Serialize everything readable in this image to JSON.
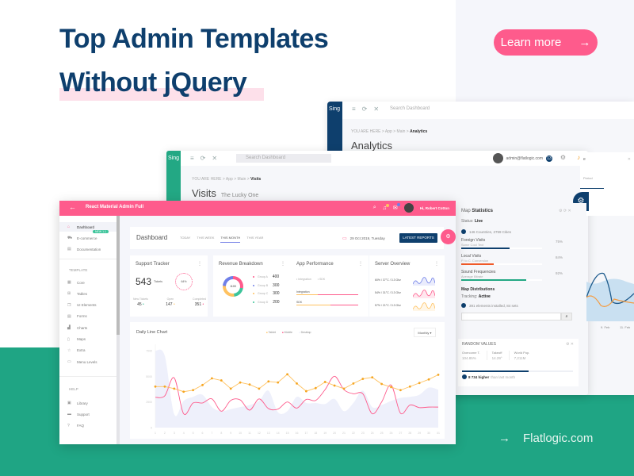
{
  "hero": {
    "title": "Top Admin Templates",
    "subtitle": "Without jQuery",
    "cta_label": "Learn more",
    "cta_arrow": "→",
    "footer_link": "Flatlogic.com",
    "footer_arrow": "→"
  },
  "colors": {
    "navy": "#0e3f6d",
    "pink": "#fe5b8c",
    "green": "#1fa584",
    "orange": "#ffc260"
  },
  "analytics_window": {
    "logo": "Sing",
    "search_placeholder": "Search Dashboard",
    "breadcrumb_prefix": "YOU ARE HERE > App > Main > ",
    "breadcrumb_current": "Analytics",
    "page_title": "Analytics"
  },
  "visits_window": {
    "logo": "Sing",
    "search_placeholder": "Search Dashboard",
    "breadcrumb_prefix": "YOU ARE HERE > App > Main > ",
    "breadcrumb_current": "Visits",
    "page_title": "Visits",
    "page_subtitle": "The Lucky One",
    "user_email": "admin@flatlogic.com",
    "user_badge": "13",
    "map_statistics": {
      "title_light": "Map",
      "title_bold": "Statistics",
      "status_label": "Status:",
      "status_value": "Live",
      "countries_text": "146 Countries, 2759 Cities",
      "rows": [
        {
          "label": "Foreign Visits",
          "sub": "Some Cool Text",
          "percent": "75%",
          "fill": 0.6,
          "color": "#0e3f6d"
        },
        {
          "label": "Local Visits",
          "sub": "P. to C. Conversion",
          "percent": "84%",
          "fill": 0.4,
          "color": "#f05a28"
        },
        {
          "label": "Sound Frequencies",
          "sub": "Average Bitrate",
          "percent": "92%",
          "fill": 0.8,
          "color": "#23a884"
        }
      ],
      "distributions_title": "Map Distributions",
      "tracking_label": "Tracking:",
      "tracking_value": "Active",
      "elements_text": "391 elements installed, 84 sets"
    },
    "random_values": {
      "title": "RANDOM VALUES",
      "columns": [
        {
          "label": "Overcome T.",
          "value": "104.85%"
        },
        {
          "label": "Takeoff",
          "value": "14.29°"
        },
        {
          "label": "World Pop.",
          "value": "7,211M"
        }
      ],
      "progress": 0.6,
      "note_bold": "8 734 higher",
      "note_rest": "than last month"
    },
    "side_panel": {
      "title": "e",
      "subtitle": "Period"
    },
    "mini_chart_ticks": [
      "9. Feb",
      "11. Feb"
    ]
  },
  "react_window": {
    "title": "React Material Admin Full",
    "user_greeting": "Hi, Robert Cotton",
    "sidebar": {
      "items": [
        {
          "label": "Dashboard",
          "icon": "home",
          "active": true
        },
        {
          "label": "E-commerce",
          "icon": "cart",
          "tag": "NEW 1.1"
        },
        {
          "label": "Documentation",
          "icon": "doc"
        }
      ],
      "template_section": "TEMPLATE",
      "template_items": [
        {
          "label": "Core",
          "icon": "grid"
        },
        {
          "label": "Tables",
          "icon": "table"
        },
        {
          "label": "UI Elements",
          "icon": "layers"
        },
        {
          "label": "Forms",
          "icon": "doc"
        },
        {
          "label": "Charts",
          "icon": "chart"
        },
        {
          "label": "Maps",
          "icon": "map"
        },
        {
          "label": "Extra",
          "icon": "star"
        },
        {
          "label": "Menu Levels",
          "icon": "folder"
        }
      ],
      "help_section": "HELP",
      "help_items": [
        {
          "label": "Library",
          "icon": "library"
        },
        {
          "label": "Support",
          "icon": "chat"
        },
        {
          "label": "FAQ",
          "icon": "help"
        }
      ]
    },
    "dashboard": {
      "title": "Dashboard",
      "tabs": [
        "TODAY",
        "THIS WEEK",
        "THIS MONTH",
        "THIS YEAR"
      ],
      "active_tab": "THIS MONTH",
      "date": "29 Oct 2019, Tuesday",
      "latest_reports_label": "LATEST REPORTS"
    },
    "support_tracker": {
      "title": "Support Tracker",
      "tickets_count": "543",
      "tickets_label": "Tickets",
      "ring_value": "64%",
      "stats": [
        {
          "label": "New Tickets",
          "value": "45"
        },
        {
          "label": "Open",
          "value": "147"
        },
        {
          "label": "Completed",
          "value": "351"
        }
      ]
    },
    "revenue_breakdown": {
      "title": "Revenue Breakdown",
      "center_value": "1100",
      "groups": [
        {
          "label": "Group A",
          "value": "400",
          "color": "#fe5b8c"
        },
        {
          "label": "Group B",
          "value": "300",
          "color": "#6f7fe8"
        },
        {
          "label": "Group C",
          "value": "300",
          "color": "#ffc260"
        },
        {
          "label": "Group D",
          "value": "200",
          "color": "#3cc49a"
        }
      ]
    },
    "app_performance": {
      "title": "App Performance",
      "legend": [
        "Integration",
        "SDK"
      ],
      "bars": [
        {
          "label": "Integration",
          "fill": 0.35
        },
        {
          "label": "SDK",
          "fill": 0.55
        }
      ]
    },
    "server_overview": {
      "title": "Server Overview",
      "rows": [
        {
          "text": "60% / 37°C / 3.3 Ghz",
          "color": "#6f7fe8"
        },
        {
          "text": "54% / 31°C / 3.3 Ghz",
          "color": "#fe5b8c"
        },
        {
          "text": "57% / 21°C / 3.3 Ghz",
          "color": "#ffc260"
        }
      ]
    },
    "daily_line_chart": {
      "title": "Daily Line Chart",
      "legend": [
        "Tablet",
        "Mobile",
        "Desktop"
      ],
      "period_select": "Monthly"
    }
  },
  "chart_data": {
    "type": "line",
    "title": "Daily Line Chart",
    "xlabel": "",
    "ylabel": "",
    "x": [
      1,
      2,
      3,
      4,
      5,
      6,
      7,
      8,
      9,
      10,
      11,
      12,
      13,
      14,
      15,
      16,
      17,
      18,
      19,
      20,
      21,
      22,
      23,
      24,
      25,
      26,
      27,
      28,
      29,
      30,
      31
    ],
    "y_ticks": [
      0,
      2500,
      5000,
      7500
    ],
    "ylim": [
      0,
      7500
    ],
    "grid": false,
    "legend_position": "top-center",
    "series": [
      {
        "name": "Tablet",
        "color": "#ffc260",
        "values": [
          4000,
          4000,
          3800,
          3500,
          3650,
          4150,
          4800,
          4600,
          3800,
          4400,
          4200,
          3800,
          4500,
          4400,
          5200,
          4300,
          3550,
          3850,
          4450,
          4100,
          3800,
          4300,
          4750,
          4900,
          4250,
          3950,
          3650,
          4000,
          4350,
          4700,
          5150
        ]
      },
      {
        "name": "Mobile",
        "color": "#fe5b8c",
        "values": [
          2950,
          3100,
          4850,
          1350,
          2400,
          2400,
          2800,
          1600,
          2650,
          2700,
          1700,
          2800,
          1850,
          1800,
          2500,
          1900,
          2750,
          2650,
          3700,
          5000,
          3700,
          3300,
          3300,
          1350,
          2500,
          4150,
          1400,
          2200,
          1950,
          2000,
          2000
        ]
      },
      {
        "name": "Desktop",
        "color": "#eef0fb",
        "values": [
          7500,
          7000,
          1300,
          2600,
          3000,
          3200,
          2000,
          1600,
          1800,
          2000,
          2200,
          2600,
          3600,
          1500,
          1600,
          3000,
          2400,
          2400,
          2300,
          2800,
          1600,
          2400,
          3600,
          2000,
          2200,
          2600,
          2900,
          3000,
          3200,
          3900,
          3700
        ]
      }
    ]
  }
}
